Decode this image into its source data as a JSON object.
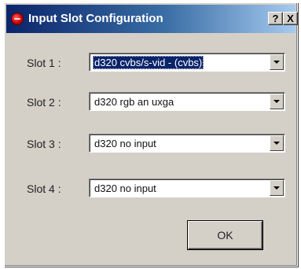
{
  "window": {
    "title": "Input Slot Configuration",
    "help_label": "?",
    "close_label": "X",
    "app_icon": "red-circle-icon"
  },
  "slots": [
    {
      "label": "Slot 1 :",
      "value": "d320 cvbs/s-vid - (cvbs)",
      "focused": true
    },
    {
      "label": "Slot 2 :",
      "value": "d320 rgb an uxga",
      "focused": false
    },
    {
      "label": "Slot 3 :",
      "value": "d320 no input",
      "focused": false
    },
    {
      "label": "Slot 4 :",
      "value": "d320 no input",
      "focused": false
    }
  ],
  "buttons": {
    "ok_label": "OK"
  },
  "colors": {
    "titlebar_start": "#0a246a",
    "titlebar_end": "#a6caf0",
    "dialog_face": "#d4d0c8",
    "selection": "#0a246a"
  }
}
